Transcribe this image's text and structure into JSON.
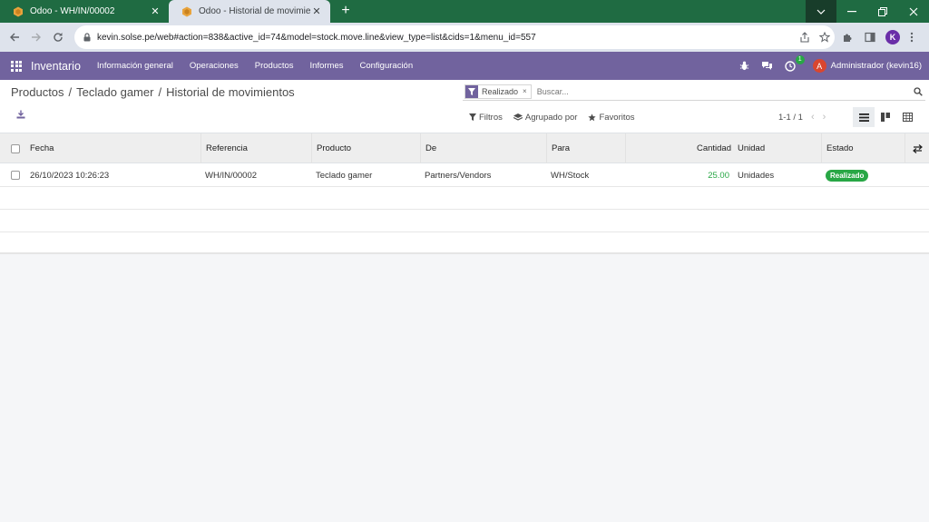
{
  "browser": {
    "tabs": [
      {
        "title": "Odoo - WH/IN/00002",
        "active": false
      },
      {
        "title": "Odoo - Historial de movimientos",
        "active": true
      }
    ],
    "new_tab": "+",
    "url": "kevin.solse.pe/web#action=838&active_id=74&model=stock.move.line&view_type=list&cids=1&menu_id=557",
    "profile_initial": "K"
  },
  "navbar": {
    "app_name": "Inventario",
    "menu": [
      "Información general",
      "Operaciones",
      "Productos",
      "Informes",
      "Configuración"
    ],
    "activity_count": "1",
    "user_initial": "A",
    "user_name": "Administrador (kevin16)",
    "color": "#71639e"
  },
  "control_panel": {
    "breadcrumb": [
      "Productos",
      "Teclado gamer",
      "Historial de movimientos"
    ],
    "facet_label": "Realizado",
    "facet_remove": "×",
    "search_placeholder": "Buscar...",
    "filters_label": "Filtros",
    "group_by_label": "Agrupado por",
    "favorites_label": "Favoritos",
    "pager": "1-1 / 1"
  },
  "table": {
    "columns": [
      "Fecha",
      "Referencia",
      "Producto",
      "De",
      "Para",
      "Cantidad",
      "Unidad",
      "Estado"
    ],
    "rows": [
      {
        "fecha": "26/10/2023 10:26:23",
        "referencia": "WH/IN/00002",
        "producto": "Teclado gamer",
        "de": "Partners/Vendors",
        "para": "WH/Stock",
        "cantidad": "25.00",
        "unidad": "Unidades",
        "estado": "Realizado"
      }
    ]
  },
  "colors": {
    "accent": "#71639e",
    "success": "#28a745",
    "chrome": "#1f6b42"
  }
}
